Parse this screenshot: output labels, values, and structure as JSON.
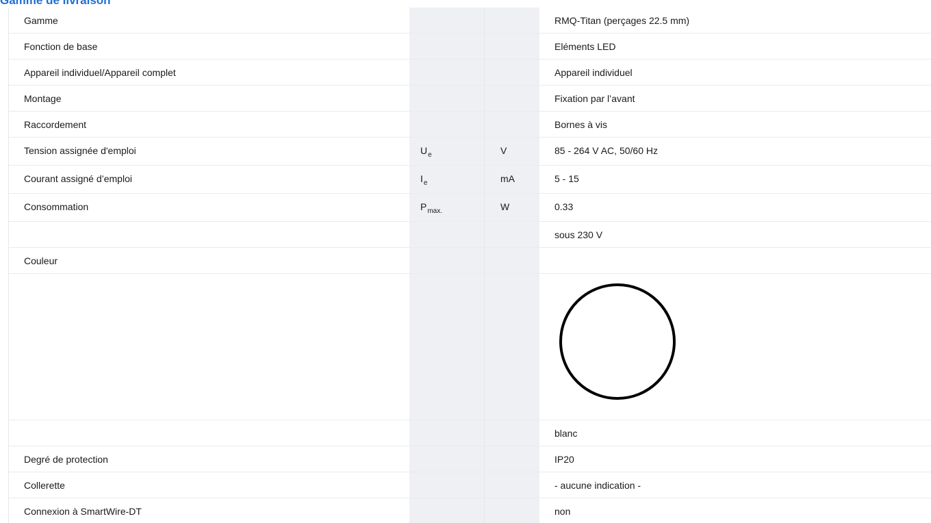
{
  "section": {
    "title": "Gamme de livraison"
  },
  "rows": [
    {
      "label": "Gamme",
      "symbol": "",
      "symbol_sub": "",
      "unit": "",
      "value": "RMQ-Titan (perçages 22.5 mm)"
    },
    {
      "label": "Fonction de base",
      "symbol": "",
      "symbol_sub": "",
      "unit": "",
      "value": "Eléments LED"
    },
    {
      "label": "Appareil individuel/Appareil complet",
      "symbol": "",
      "symbol_sub": "",
      "unit": "",
      "value": "Appareil individuel"
    },
    {
      "label": "Montage",
      "symbol": "",
      "symbol_sub": "",
      "unit": "",
      "value": "Fixation par l’avant"
    },
    {
      "label": "Raccordement",
      "symbol": "",
      "symbol_sub": "",
      "unit": "",
      "value": "Bornes à vis"
    },
    {
      "label": "Tension assignée d'emploi",
      "symbol": "U",
      "symbol_sub": "e",
      "unit": "V",
      "value": "85 - 264 V AC, 50/60 Hz"
    },
    {
      "label": "Courant assigné d’emploi",
      "symbol": "I",
      "symbol_sub": "e",
      "unit": "mA",
      "value": "5 - 15"
    },
    {
      "label": "Consommation",
      "symbol": "P",
      "symbol_sub": "max.",
      "unit": "W",
      "value": "0.33"
    },
    {
      "label": "",
      "symbol": "",
      "symbol_sub": "",
      "unit": "",
      "value": "sous 230 V"
    },
    {
      "label": "Couleur",
      "symbol": "",
      "symbol_sub": "",
      "unit": "",
      "value": ""
    },
    {
      "label": "",
      "symbol": "",
      "symbol_sub": "",
      "unit": "",
      "value": "",
      "icon": "white-circle-color-icon"
    },
    {
      "label": "",
      "symbol": "",
      "symbol_sub": "",
      "unit": "",
      "value": "blanc"
    },
    {
      "label": "Degré de protection",
      "symbol": "",
      "symbol_sub": "",
      "unit": "",
      "value": "IP20"
    },
    {
      "label": "Collerette",
      "symbol": "",
      "symbol_sub": "",
      "unit": "",
      "value": "- aucune indication -"
    },
    {
      "label": "Connexion à SmartWire-DT",
      "symbol": "",
      "symbol_sub": "",
      "unit": "",
      "value": "non"
    }
  ],
  "colors": {
    "title": "#1f6fd1",
    "shaded_column": "#eef0f4",
    "row_border": "#e9ebee"
  }
}
